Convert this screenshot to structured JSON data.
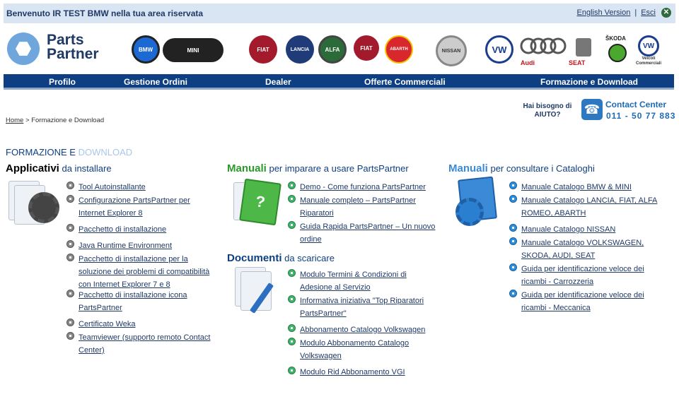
{
  "topbar": {
    "welcome": "Benvenuto IR TEST BMW nella tua area riservata",
    "english_link": "English Version",
    "separator": "|",
    "logout_link": "Esci",
    "close_symbol": "✕"
  },
  "logo": {
    "line1": "Parts",
    "line2": "Partner"
  },
  "brands": [
    {
      "name": "BMW",
      "label": "BMW",
      "color": "#1c69d4"
    },
    {
      "name": "MINI",
      "label": "MINI",
      "color": "#222222"
    },
    {
      "name": "FIAT",
      "label": "FIAT",
      "color": "#a31a2c"
    },
    {
      "name": "LANCIA",
      "label": "LANCIA",
      "color": "#1f3c78"
    },
    {
      "name": "Alfa Romeo",
      "label": "ALFA",
      "color": "#2b6b3a"
    },
    {
      "name": "FIAT Professional",
      "label": "FIAT",
      "color": "#a31a2c"
    },
    {
      "name": "Abarth",
      "label": "ABARTH",
      "color": "#d8282e"
    },
    {
      "name": "NISSAN",
      "label": "NISSAN",
      "color": "#888888"
    },
    {
      "name": "Volkswagen",
      "label": "VW",
      "color": "#1a3d8f"
    },
    {
      "name": "Audi",
      "label": "Audi",
      "color": "#ffffff"
    },
    {
      "name": "SEAT",
      "label": "SEAT",
      "color": "#ffffff"
    },
    {
      "name": "ŠKODA",
      "label": "ŠKODA",
      "color": "#4ba82e"
    },
    {
      "name": "Veicoli Commerciali",
      "label": "VW",
      "color": "#1a3d8f"
    }
  ],
  "brand_texts": {
    "audi": "Audi",
    "seat": "SEAT",
    "skoda": "ŠKODA",
    "vw_comm": "Veicoli Commerciali"
  },
  "nav": {
    "profilo": "Profilo",
    "gestione": "Gestione Ordini",
    "dealer": "Dealer",
    "offerte": "Offerte Commerciali",
    "formazione": "Formazione e Download"
  },
  "help": {
    "text": "Hai bisogno di AIUTO?",
    "cc_title": "Contact Center",
    "cc_phone": "011 - 50 77 883"
  },
  "breadcrumb": {
    "home": "Home",
    "sep": ">",
    "current": "Formazione e Download"
  },
  "page_title": {
    "part1": "FORMAZIONE E",
    "part2": "DOWNLOAD"
  },
  "col1": {
    "head_big": "Applicativi",
    "head_rest": "da installare",
    "links": [
      "Tool Autoinstallante",
      "Configurazione PartsPartner per Internet Explorer 8",
      "Pacchetto di installazione",
      "Java Runtime Environment",
      "Pacchetto di installazione per la soluzione dei problemi di compatibilità con Internet Explorer 7 e 8",
      "Pacchetto di installazione icona PartsPartner",
      "Certificato Weka",
      "Teamviewer (supporto remoto Contact Center)"
    ]
  },
  "col2": {
    "head_big": "Manuali",
    "head_rest": "per imparare a usare PartsPartner",
    "links": [
      "Demo - Come funziona PartsPartner",
      "Manuale completo – PartsPartner Riparatori",
      "Guida Rapida PartsPartner – Un nuovo ordine"
    ],
    "docs_head_big": "Documenti",
    "docs_head_rest": "da scaricare",
    "docs": [
      "Modulo Termini & Condizioni di Adesione al Servizio",
      "Informativa iniziativa \"Top Riparatori PartsPartner\"",
      "Abbonamento Catalogo Volkswagen",
      "Modulo Abbonamento Catalogo Volkswagen",
      "Modulo Rid Abbonamento VGI"
    ]
  },
  "col3": {
    "head_big": "Manuali",
    "head_rest": "per consultare i Cataloghi",
    "links": [
      "Manuale Catalogo BMW & MINI",
      "Manuale Catalogo LANCIA, FIAT, ALFA ROMEO, ABARTH",
      "Manuale Catalogo NISSAN",
      "Manuale Catalogo VOLKSWAGEN, SKODA, AUDI, SEAT",
      "Guida per identificazione veloce dei ricambi - Carrozzeria",
      "Guida per identificazione veloce dei ricambi - Meccanica"
    ]
  },
  "colors": {
    "brand_blue": "#0e3f82",
    "manual_green": "#2a9a2a",
    "manual_blue": "#3a8ad8"
  }
}
